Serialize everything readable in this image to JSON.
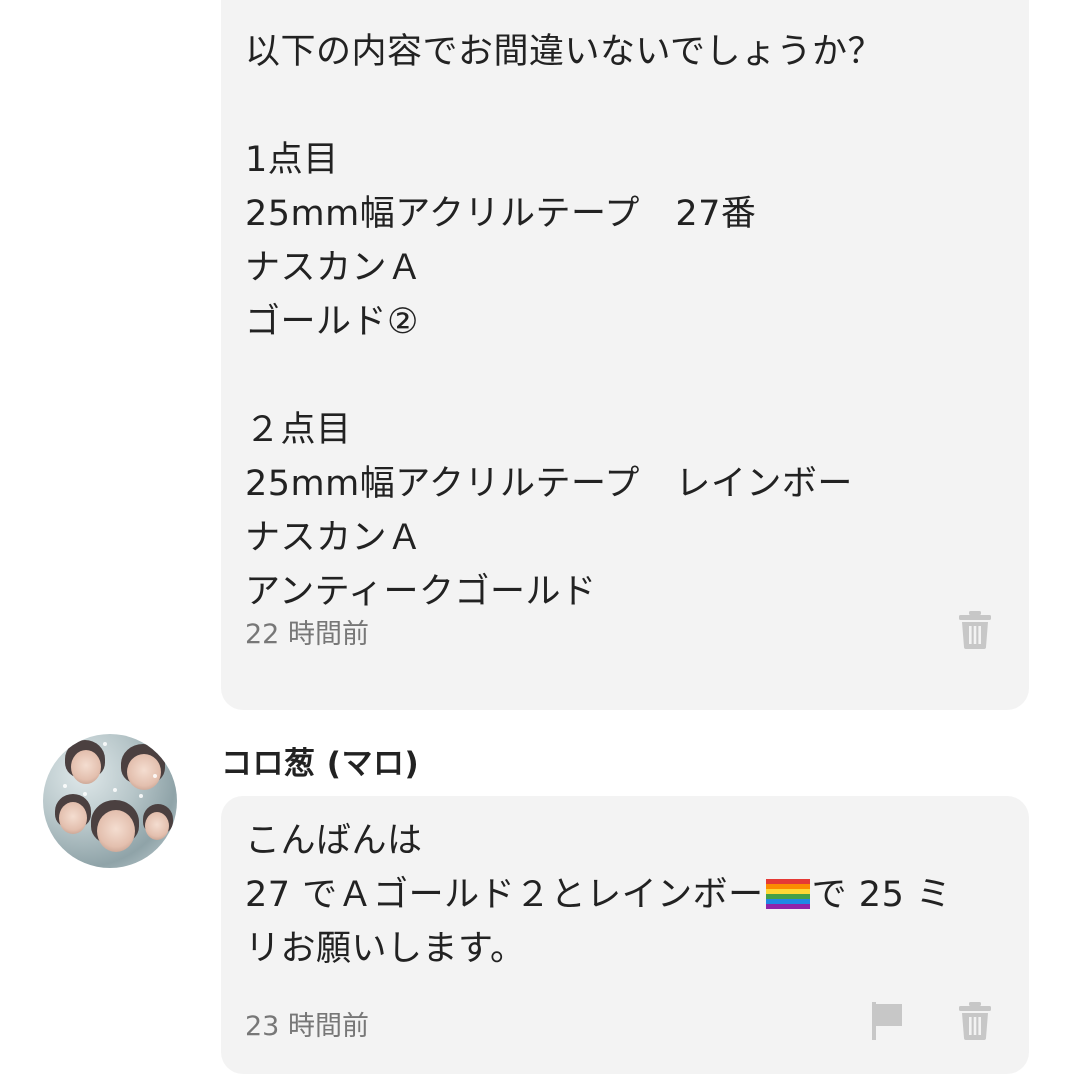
{
  "messages": [
    {
      "text": "以下の内容でお間違いないでしょうか？\n\n1点目\n25mm幅アクリルテープ　27番\nナスカンＡ\nゴールド②\n\n２点目\n25mm幅アクリルテープ　レインボー\nナスカンＡ\nアンティークゴールド",
      "time": "22 時間前"
    },
    {
      "user": "コロ葱 (マロ)",
      "text_line1": "こんばんは",
      "text_line2_before": "27 でＡゴールド２とレインボー",
      "text_line2_after": "で 25 ミ",
      "text_line3": "リお願いします。",
      "emoji": "rainbow-flag-emoji",
      "time": "23 時間前"
    }
  ],
  "icons": {
    "delete": "trash-icon",
    "report": "flag-icon",
    "icon_color": "#c7c7c7"
  },
  "colors": {
    "bubble_bg": "#f3f3f3",
    "text": "#222222",
    "timestamp": "#777777"
  }
}
